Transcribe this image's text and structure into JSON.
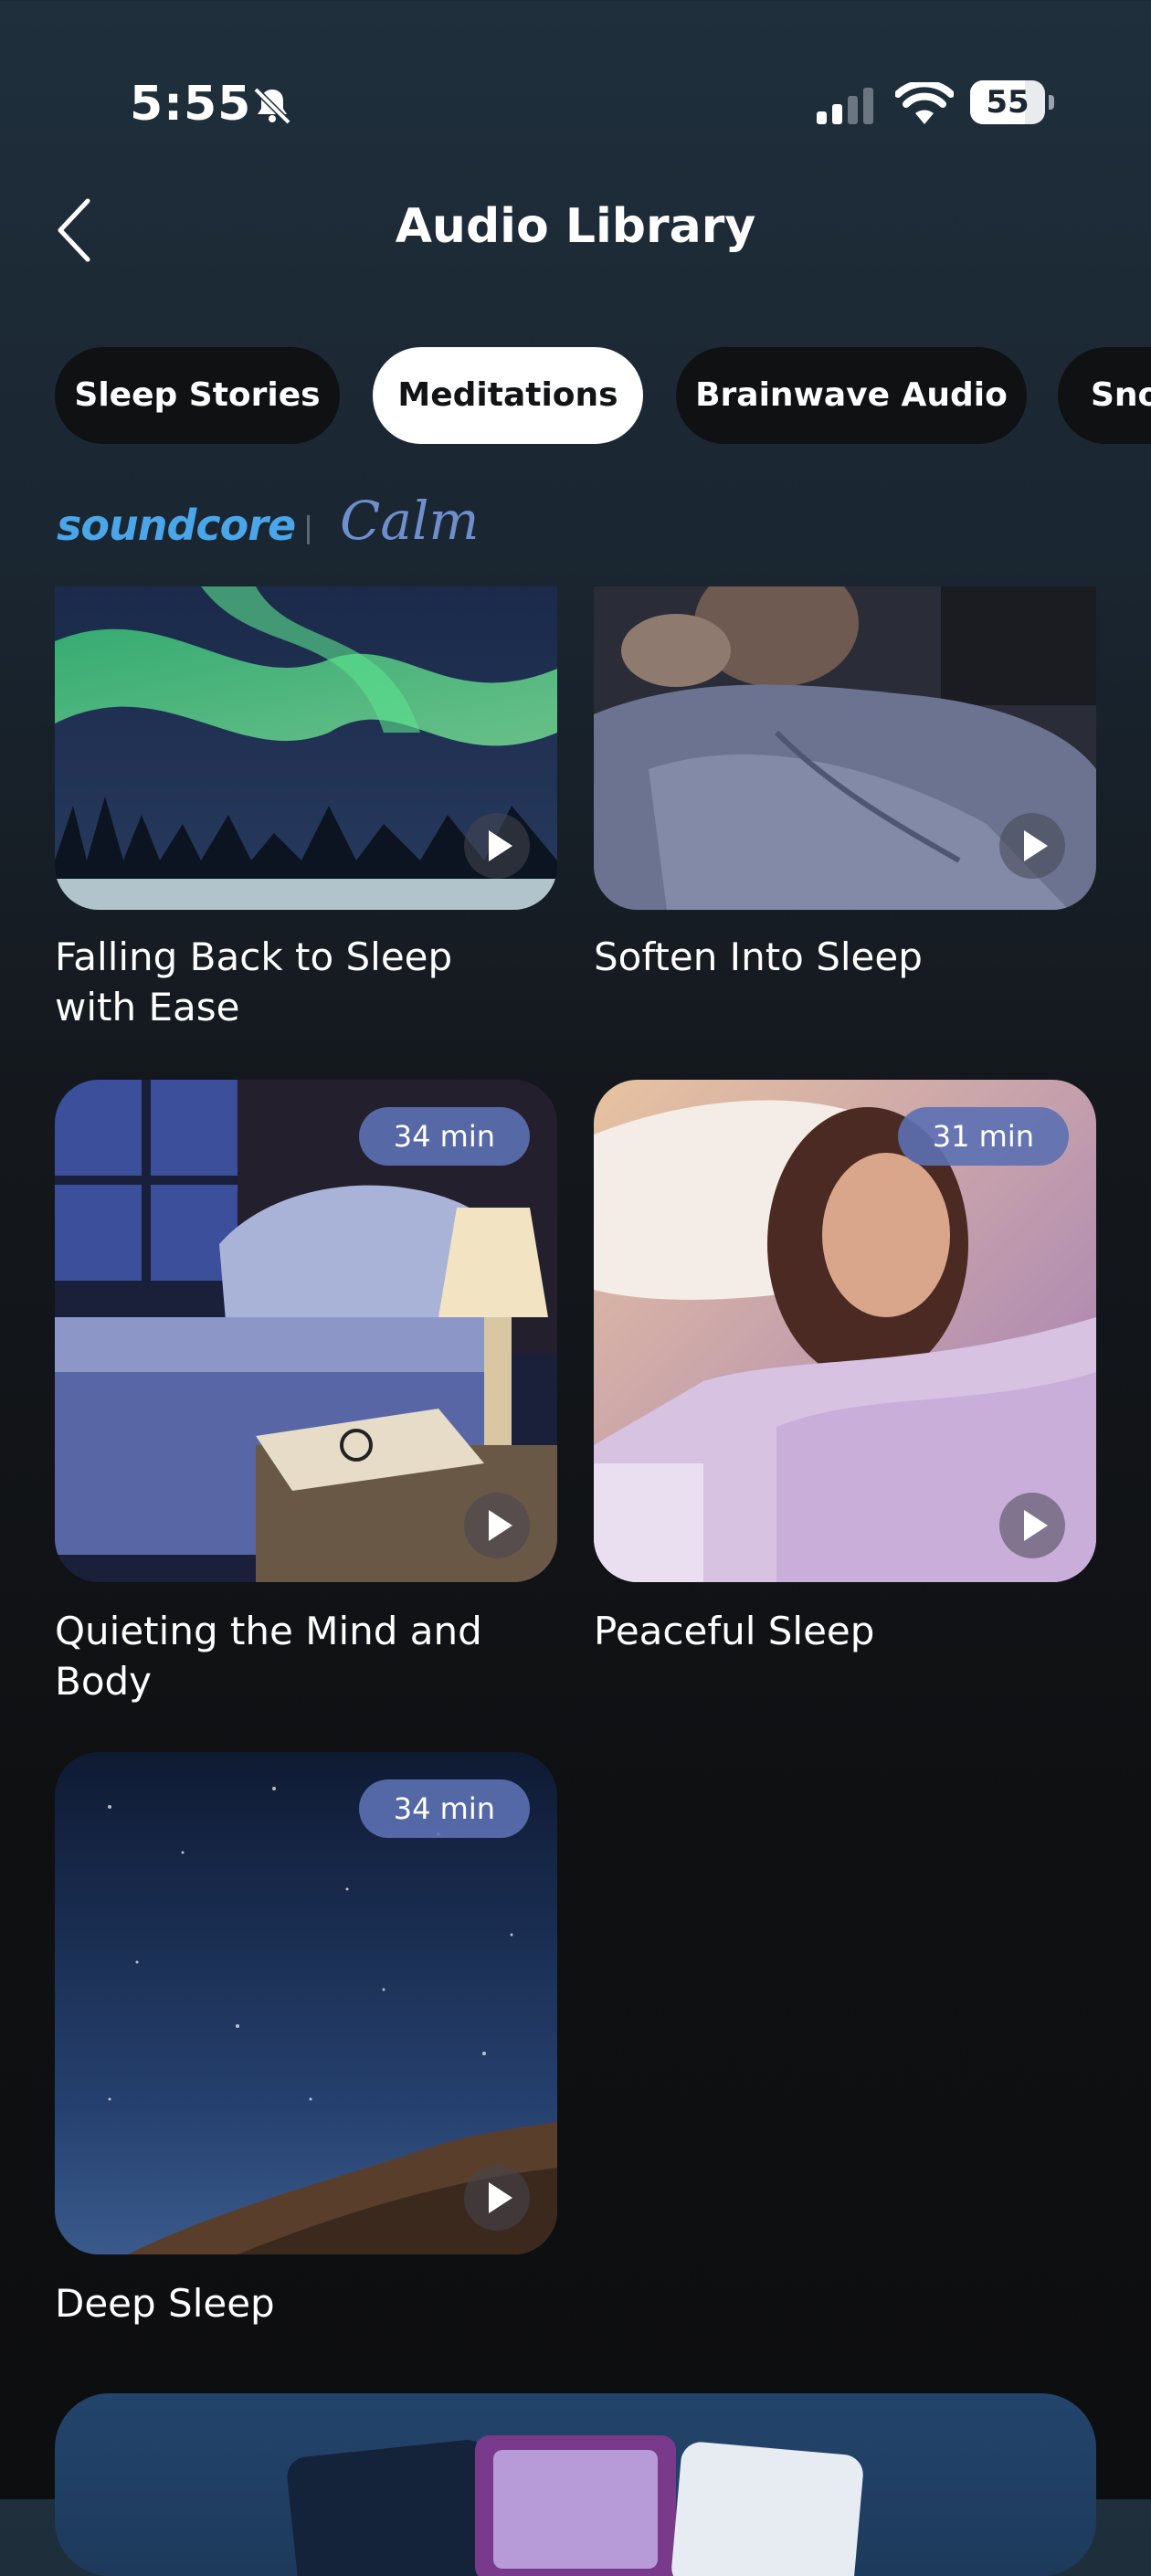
{
  "status": {
    "time": "5:55",
    "battery": "55",
    "icons": [
      "bell-slash-icon",
      "signal-icon",
      "wifi-icon",
      "battery-icon"
    ]
  },
  "header": {
    "title": "Audio Library",
    "back_icon": "chevron-left-icon"
  },
  "tabs": [
    {
      "label": "Sleep Stories",
      "active": false
    },
    {
      "label": "Meditations",
      "active": true
    },
    {
      "label": "Brainwave Audio",
      "active": false
    },
    {
      "label": "Snoring",
      "active": false
    }
  ],
  "brand": {
    "soundcore": "soundcore",
    "calm": "Calm"
  },
  "items": [
    {
      "title": "Falling Back to Sleep with Ease",
      "duration": ""
    },
    {
      "title": "Soften Into Sleep",
      "duration": ""
    },
    {
      "title": "Quieting the Mind and Body",
      "duration": "34 min"
    },
    {
      "title": "Peaceful Sleep",
      "duration": "31 min"
    },
    {
      "title": "Deep Sleep",
      "duration": "34 min"
    }
  ],
  "colors": {
    "accent": "#4aa6e8",
    "duration_badge": "#5c70b2",
    "active_tab": "#ffffff"
  }
}
